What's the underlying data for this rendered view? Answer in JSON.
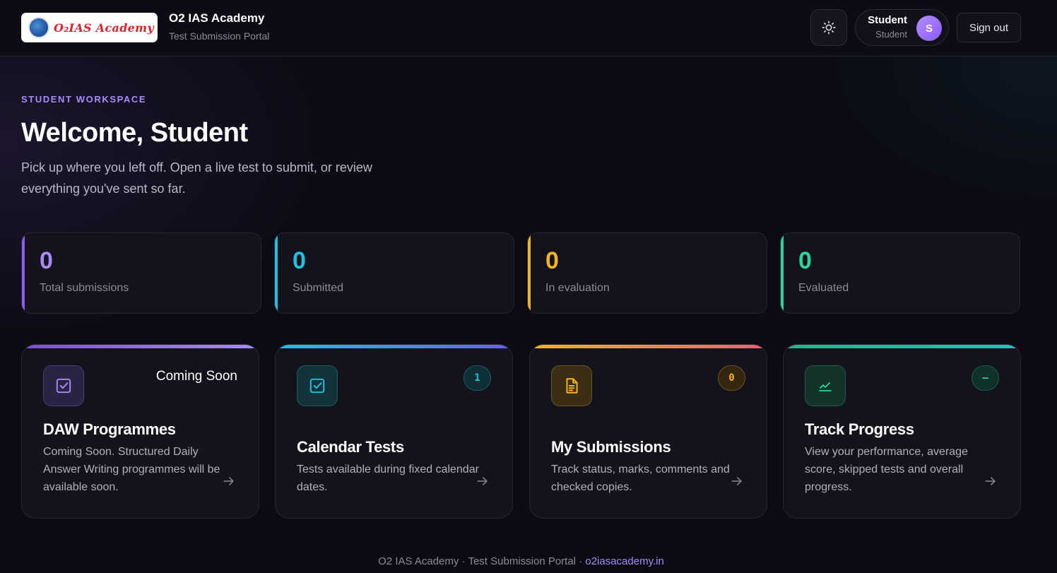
{
  "header": {
    "logo_text": "O₂IAS Academy",
    "brand_title": "O2 IAS Academy",
    "brand_subtitle": "Test Submission Portal",
    "user_name": "Student",
    "user_role": "Student",
    "avatar_initial": "S",
    "signout_label": "Sign out",
    "theme_icon": "sun-icon"
  },
  "hero": {
    "eyebrow": "STUDENT WORKSPACE",
    "title": "Welcome, Student",
    "intro": "Pick up where you left off. Open a live test to submit, or review everything you've sent so far."
  },
  "stats": [
    {
      "value": "0",
      "label": "Total submissions",
      "color": "#8b5cf6"
    },
    {
      "value": "0",
      "label": "Submitted",
      "color": "#22c1e0"
    },
    {
      "value": "0",
      "label": "In evaluation",
      "color": "#f5b324"
    },
    {
      "value": "0",
      "label": "Evaluated",
      "color": "#2ed39a"
    }
  ],
  "cards": [
    {
      "title": "DAW Programmes",
      "status": "Coming Soon",
      "description": "Coming Soon. Structured Daily Answer Writing programmes will be available soon.",
      "icon": "checkbox-icon",
      "color": "#8b5cf6"
    },
    {
      "title": "Calendar Tests",
      "badge": "1",
      "description": "Tests available during fixed calendar dates.",
      "icon": "checkbox-icon",
      "color": "#22c1e0"
    },
    {
      "title": "My Submissions",
      "badge": "0",
      "description": "Track status, marks, comments and checked copies.",
      "icon": "document-icon",
      "color": "#f5b324"
    },
    {
      "title": "Track Progress",
      "badge": "–",
      "description": "View your performance, average score, skipped tests and overall progress.",
      "icon": "chart-line-icon",
      "color": "#2ed39a"
    }
  ],
  "footer": {
    "text": "O2 IAS Academy · Test Submission Portal · ",
    "link": "o2iasacademy.in"
  }
}
